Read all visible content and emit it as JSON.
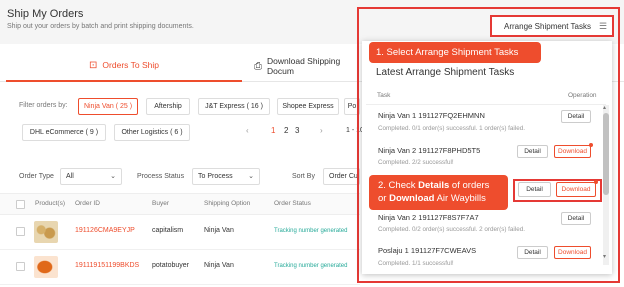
{
  "header": {
    "title": "Ship My Orders",
    "subtitle": "Ship out your orders by batch and print shipping documents."
  },
  "tabs": [
    {
      "label": "Orders To Ship",
      "icon": "box-icon"
    },
    {
      "label": "Download Shipping Docum",
      "icon": "printer-icon"
    }
  ],
  "filter": {
    "label": "Filter orders by:",
    "chips": [
      {
        "label": "Ninja Van ( 25 )",
        "active": true
      },
      {
        "label": "Aftership"
      },
      {
        "label": "J&T Express ( 16 )"
      },
      {
        "label": "Shopee Express"
      },
      {
        "label": "Po"
      },
      {
        "label": "DHL eCommerce ( 9 )"
      },
      {
        "label": "Other Logistics ( 6 )"
      }
    ]
  },
  "pagination": {
    "prev": "‹",
    "pages": [
      "1",
      "2",
      "3"
    ],
    "current": "1",
    "next": "›",
    "range": "1 - 10"
  },
  "controls": {
    "order_type_label": "Order Type",
    "order_type_value": "All",
    "process_status_label": "Process Status",
    "process_status_value": "To Process",
    "sort_by_label": "Sort By",
    "sort_by_value": "Order Cu"
  },
  "table": {
    "columns": [
      "Product(s)",
      "Order ID",
      "Buyer",
      "Shipping Option",
      "Order Status"
    ],
    "rows": [
      {
        "order_id": "191126CMA9EYJP",
        "buyer": "capitalism",
        "shipping": "Ninja Van",
        "status": "Tracking number generated"
      },
      {
        "order_id": "191119151199BKDS",
        "buyer": "potatobuyer",
        "shipping": "Ninja Van",
        "status": "Tracking number generated"
      }
    ]
  },
  "panel": {
    "button_label": "Arrange Shipment Tasks",
    "title": "Latest Arrange Shipment Tasks",
    "col_task": "Task",
    "col_operation": "Operation",
    "tasks": [
      {
        "name": "Ninja Van 1 191127FQ2EHMNN",
        "status": "Completed. 0/1 order(s) successful. 1 order(s) failed.",
        "buttons": [
          "Detail"
        ]
      },
      {
        "name": "Ninja Van 2 191127F8PHD5T5",
        "status": "Completed. 2/2 successful!",
        "buttons": [
          "Detail",
          "Download"
        ]
      },
      {
        "name": "Ninja Van 2 191127F8S7F7A7",
        "status": "Completed. 0/2 order(s) successful. 2 order(s) failed.",
        "buttons": [
          "Detail"
        ]
      },
      {
        "name": "Poslaju 1 191127F7CWEAVS",
        "status": "Completed. 1/1 successful!",
        "buttons": [
          "Detail",
          "Download"
        ]
      }
    ],
    "highlight_buttons": [
      "Detail",
      "Download"
    ]
  },
  "callouts": {
    "c1": "1. Select Arrange Shipment Tasks",
    "c2_prefix": "2. Check ",
    "c2_bold1": "Details",
    "c2_mid": " of orders",
    "c2_line2_prefix": "or ",
    "c2_bold2": "Download",
    "c2_suffix": " Air Waybills"
  },
  "colors": {
    "accent": "#ee4d2d",
    "highlight": "#e53935",
    "tracking": "#26aa99"
  }
}
